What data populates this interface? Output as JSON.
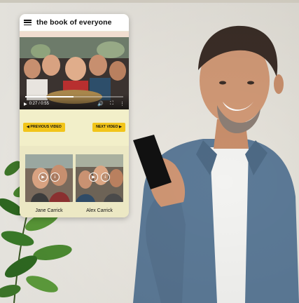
{
  "app": {
    "title": "the book of everyone"
  },
  "video": {
    "time": "0:27 / 0:55",
    "progress": 0.49
  },
  "navigation": {
    "previous_label": "◀ PREVIOUS VIDEO",
    "next_label": "NEXT VIDEO ▶"
  },
  "cards": [
    {
      "name": "Jane Carrick"
    },
    {
      "name": "Alex Carrick"
    }
  ],
  "icons": {
    "menu": "menu-icon",
    "play": "play-icon",
    "volume": "volume-icon",
    "fullscreen": "fullscreen-icon",
    "more": "more-icon",
    "download": "download-icon"
  },
  "colors": {
    "accent_yellow": "#f2c51a",
    "phone_background": "#f2efc9"
  }
}
